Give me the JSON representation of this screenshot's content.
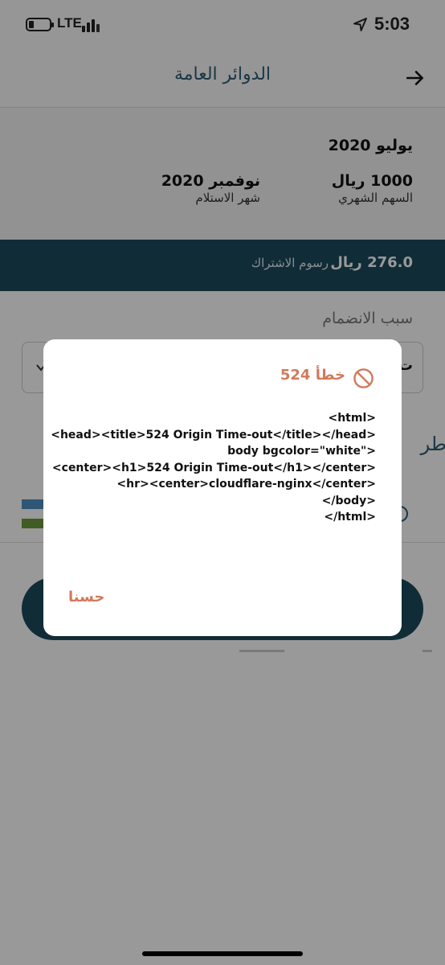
{
  "status_bar": {
    "network": "LTE",
    "time": "5:03",
    "icons": [
      "battery-icon",
      "signal-icon",
      "location-arrow-icon"
    ]
  },
  "header": {
    "title": "الدوائر العامة",
    "back_icon": "arrow-right-icon"
  },
  "summary": {
    "month": "يوليو 2020",
    "share_value": "1000 ريال",
    "share_label": "السهم الشهري",
    "receive_value": "نوفمبر 2020",
    "receive_label": "شهر الاستلام"
  },
  "fee": {
    "value": "276.0 ريال",
    "label": "رسوم الاشتراك"
  },
  "join": {
    "label": "سبب الانضمام",
    "selected_partial": "ت"
  },
  "payment": {
    "label_partial": "طر"
  },
  "dialog": {
    "title": "خطأ 524",
    "body_lines": [
      "<html>",
      "<head><title>524 Origin Time-out</title></head>",
      "<\"body bgcolor=\"white",
      "<center><h1>524 Origin Time-out</h1></center>",
      "<hr><center>cloudflare-nginx</center>",
      "<body/>",
      "<html/>"
    ],
    "ok_label": "حسنا"
  },
  "colors": {
    "primary": "#1b4a5c",
    "accent": "#d17a5c",
    "title_text": "#2e5d73"
  }
}
